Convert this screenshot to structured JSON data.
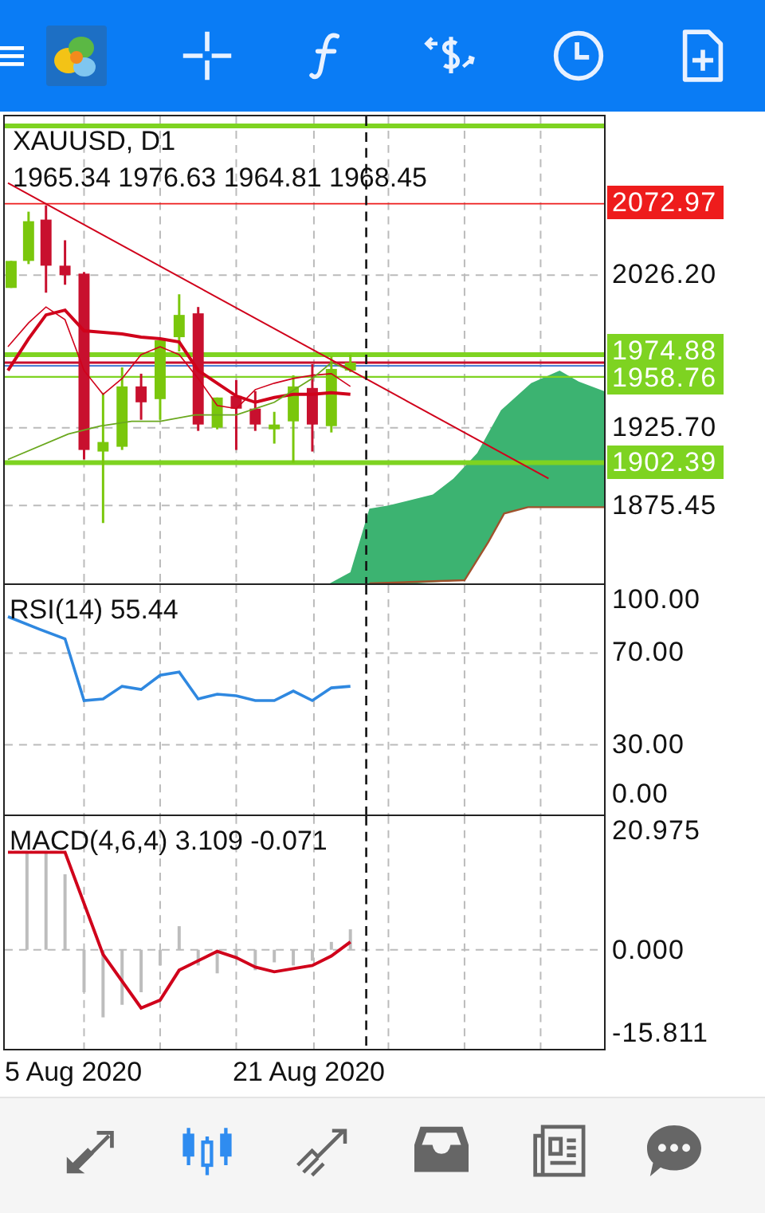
{
  "chart": {
    "symbol": "XAUUSD, D1",
    "ohlc": "1965.34 1976.63 1964.81 1968.45",
    "price_scale": [
      {
        "label": "2072.97",
        "kind": "tag",
        "color": "#ee1c1c"
      },
      {
        "label": "2026.20",
        "kind": "tick"
      },
      {
        "label": "1974.88",
        "kind": "tag",
        "color": "#7ed321"
      },
      {
        "label": "1958.76",
        "kind": "tag",
        "color": "#7ed321"
      },
      {
        "label": "1925.70",
        "kind": "tick"
      },
      {
        "label": "1902.39",
        "kind": "tag",
        "color": "#7ed321"
      },
      {
        "label": "1875.45",
        "kind": "tick"
      }
    ]
  },
  "rsi": {
    "title": "RSI(14) 55.44",
    "scale": [
      "100.00",
      "70.00",
      "30.00",
      "0.00"
    ]
  },
  "macd": {
    "title": "MACD(4,6,4) 3.109 -0.071",
    "scale": [
      "20.975",
      "0.000",
      "-15.811"
    ]
  },
  "dates": [
    "5 Aug 2020",
    "21 Aug 2020"
  ],
  "bottom_nav": [
    {
      "kind": "quotes",
      "selected": false
    },
    {
      "kind": "chart",
      "selected": true
    },
    {
      "kind": "trade",
      "selected": false
    },
    {
      "kind": "history",
      "selected": false
    },
    {
      "kind": "news",
      "selected": false
    },
    {
      "kind": "chat",
      "selected": false
    }
  ]
}
